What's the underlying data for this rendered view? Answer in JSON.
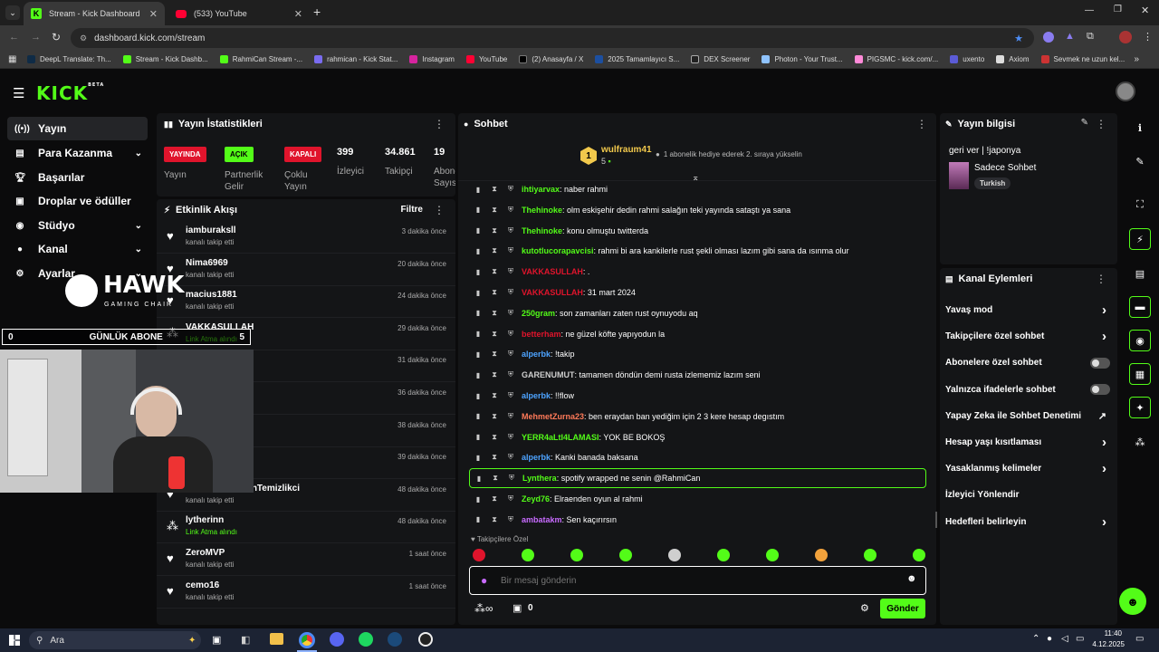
{
  "browser": {
    "tabs": [
      {
        "title": "Stream - Kick Dashboard"
      },
      {
        "title": "(533) YouTube"
      }
    ],
    "url": "dashboard.kick.com/stream",
    "bookmarks": [
      "DeepL Translate: Th...",
      "Stream - Kick Dashb...",
      "RahmiCan Stream -...",
      "rahmican - Kick Stat...",
      "Instagram",
      "YouTube",
      "(2) Anasayfa / X",
      "2025 Tamamlayıcı S...",
      "DEX Screener",
      "Photon - Your Trust...",
      "PIGSMC - kick.com/...",
      "uxento",
      "Axiom",
      "Sevmek ne uzun kel..."
    ]
  },
  "kick": {
    "logo": "KICK",
    "beta": "BETA"
  },
  "nav": [
    {
      "label": "Yayın",
      "icon": "broadcast-icon"
    },
    {
      "label": "Para Kazanma",
      "icon": "money-icon"
    },
    {
      "label": "Başarılar",
      "icon": "trophy-icon"
    },
    {
      "label": "Droplar ve ödüller",
      "icon": "gift-icon"
    },
    {
      "label": "Stüdyo",
      "icon": "studio-icon"
    },
    {
      "label": "Kanal",
      "icon": "user-icon"
    },
    {
      "label": "Ayarlar",
      "icon": "gear-icon"
    }
  ],
  "overlay": {
    "hawk": "HAWK",
    "gaming": "GAMING CHAIR",
    "counter": "0",
    "label": "GÜNLÜK ABONE",
    "right": "5"
  },
  "stats": {
    "title": "Yayın İstatistikleri",
    "badges": [
      {
        "badge": "YAYINDA",
        "label": "Yayın",
        "color": "#e0142c"
      },
      {
        "badge": "AÇIK",
        "label": "Partnerlik Gelir",
        "color": "#53fc18"
      },
      {
        "badge": "KAPALI",
        "label": "Çoklu Yayın",
        "color": "#e0142c"
      }
    ],
    "numbers": [
      {
        "value": "399",
        "label": "İzleyici"
      },
      {
        "value": "34.861",
        "label": "Takipçi"
      },
      {
        "value": "19",
        "label": "Abone Sayısı"
      }
    ]
  },
  "activity": {
    "title": "Etkinlik Akışı",
    "filter": "Filtre",
    "items": [
      {
        "name": "iamburaksll",
        "sub": "kanalı takip etti",
        "time": "3 dakika önce",
        "icon": "heart"
      },
      {
        "name": "Nima6969",
        "sub": "kanalı takip etti",
        "time": "20 dakika önce",
        "icon": "heart"
      },
      {
        "name": "macius1881",
        "sub": "kanalı takip etti",
        "time": "24 dakika önce",
        "icon": "heart"
      },
      {
        "name": "VAKKASULLAH",
        "sub": "Link Atma alındı",
        "time": "29 dakika önce",
        "icon": "redeem",
        "green": true
      },
      {
        "name": "",
        "sub": "",
        "time": "31 dakika önce",
        "icon": ""
      },
      {
        "name": "",
        "sub": "",
        "time": "36 dakika önce",
        "icon": ""
      },
      {
        "name": "",
        "sub": "",
        "time": "38 dakika önce",
        "icon": ""
      },
      {
        "name": "",
        "sub": "",
        "time": "39 dakika önce",
        "icon": ""
      },
      {
        "name": "AmerikayaGidenTemizlikci",
        "sub": "kanalı takip etti",
        "time": "48 dakika önce",
        "icon": "heart"
      },
      {
        "name": "lytherinn",
        "sub": "Link Atma alındı",
        "time": "48 dakika önce",
        "icon": "redeem",
        "green": true
      },
      {
        "name": "ZeroMVP",
        "sub": "kanalı takip etti",
        "time": "1 saat önce",
        "icon": "heart"
      },
      {
        "name": "cemo16",
        "sub": "kanalı takip etti",
        "time": "1 saat önce",
        "icon": "heart"
      }
    ]
  },
  "chat": {
    "title": "Sohbet",
    "top_user": "wulfraum41",
    "top_rank": "1",
    "top_count": "5",
    "gift_note": "1 abonelik hediye ederek 2. sıraya yükselin",
    "messages": [
      {
        "user": "ihtiyarvax",
        "color": "#53fc18",
        "text": ": naber rahmi"
      },
      {
        "user": "Thehinoke",
        "color": "#53fc18",
        "text": ": olm eskişehir dedin rahmi salağın teki yayında sataştı ya sana"
      },
      {
        "user": "Thehinoke",
        "color": "#53fc18",
        "text": ": konu olmuştu twitterda"
      },
      {
        "user": "kutotlucorapavcisi",
        "color": "#53fc18",
        "text": ": rahmi bi ara kankilerle rust şekli olması lazım gibi sana da ısınma olur"
      },
      {
        "user": "VAKKASULLAH",
        "color": "#e0142c",
        "text": ": ."
      },
      {
        "user": "VAKKASULLAH",
        "color": "#e0142c",
        "text": ": 31 mart 2024"
      },
      {
        "user": "250gram",
        "color": "#53fc18",
        "text": ": son zamanları zaten rust oynuyodu aq"
      },
      {
        "user": "betterham",
        "color": "#e0142c",
        "text": ": ne güzel köfte yapıyodun la"
      },
      {
        "user": "alperbk",
        "color": "#4da3ff",
        "text": ": !takip"
      },
      {
        "user": "GARENUMUT",
        "color": "#cfcfcf",
        "text": ": tamamen döndün demi rusta izlememiz lazım seni"
      },
      {
        "user": "alperbk",
        "color": "#4da3ff",
        "text": ": !!flow"
      },
      {
        "user": "MehmetZurna23",
        "color": "#ff7a59",
        "text": ": ben eraydan ban yediğim için 2 3 kere hesap degıstım"
      },
      {
        "user": "YERR4aLtI4LAMASI",
        "color": "#53fc18",
        "text": ": YOK BE BOKOŞ"
      },
      {
        "user": "alperbk",
        "color": "#4da3ff",
        "text": ": Kanki banada baksana"
      },
      {
        "user": "Lynthera",
        "color": "#53fc18",
        "text": ": spotify wrapped ne senin @RahmiCan",
        "highlight": true
      },
      {
        "user": "Zeyd76",
        "color": "#53fc18",
        "text": ": Elraenden oyun al rahmi"
      },
      {
        "user": "ambatakm",
        "color": "#c86bff",
        "text": ": Sen kaçırırsın"
      }
    ],
    "followers_only": "Takipçilere Özel",
    "placeholder": "Bir mesaj gönderin",
    "count": "0",
    "send": "Gönder"
  },
  "stream_info": {
    "title": "Yayın bilgisi",
    "stream_title": "geri ver | !japonya",
    "category": "Sadece Sohbet",
    "tag": "Turkish"
  },
  "channel_actions": {
    "title": "Kanal Eylemleri",
    "items": [
      {
        "label": "Yavaş mod",
        "kind": "chevron"
      },
      {
        "label": "Takipçilere özel sohbet",
        "kind": "chevron"
      },
      {
        "label": "Abonelere özel sohbet",
        "kind": "toggle"
      },
      {
        "label": "Yalnızca ifadelerle sohbet",
        "kind": "toggle"
      },
      {
        "label": "Yapay Zeka ile Sohbet Denetimi",
        "kind": "external"
      },
      {
        "label": "Hesap yaşı kısıtlaması",
        "kind": "chevron"
      },
      {
        "label": "Yasaklanmış kelimeler",
        "kind": "chevron"
      },
      {
        "label": "İzleyici Yönlendir",
        "kind": "none"
      },
      {
        "label": "Hedefleri belirleyin",
        "kind": "chevron"
      }
    ]
  },
  "taskbar": {
    "search": "Ara",
    "time": "11:40",
    "date": "4.12.2025"
  },
  "colors": {
    "accent": "#53fc18",
    "live": "#e0142c",
    "panel": "#141517"
  }
}
